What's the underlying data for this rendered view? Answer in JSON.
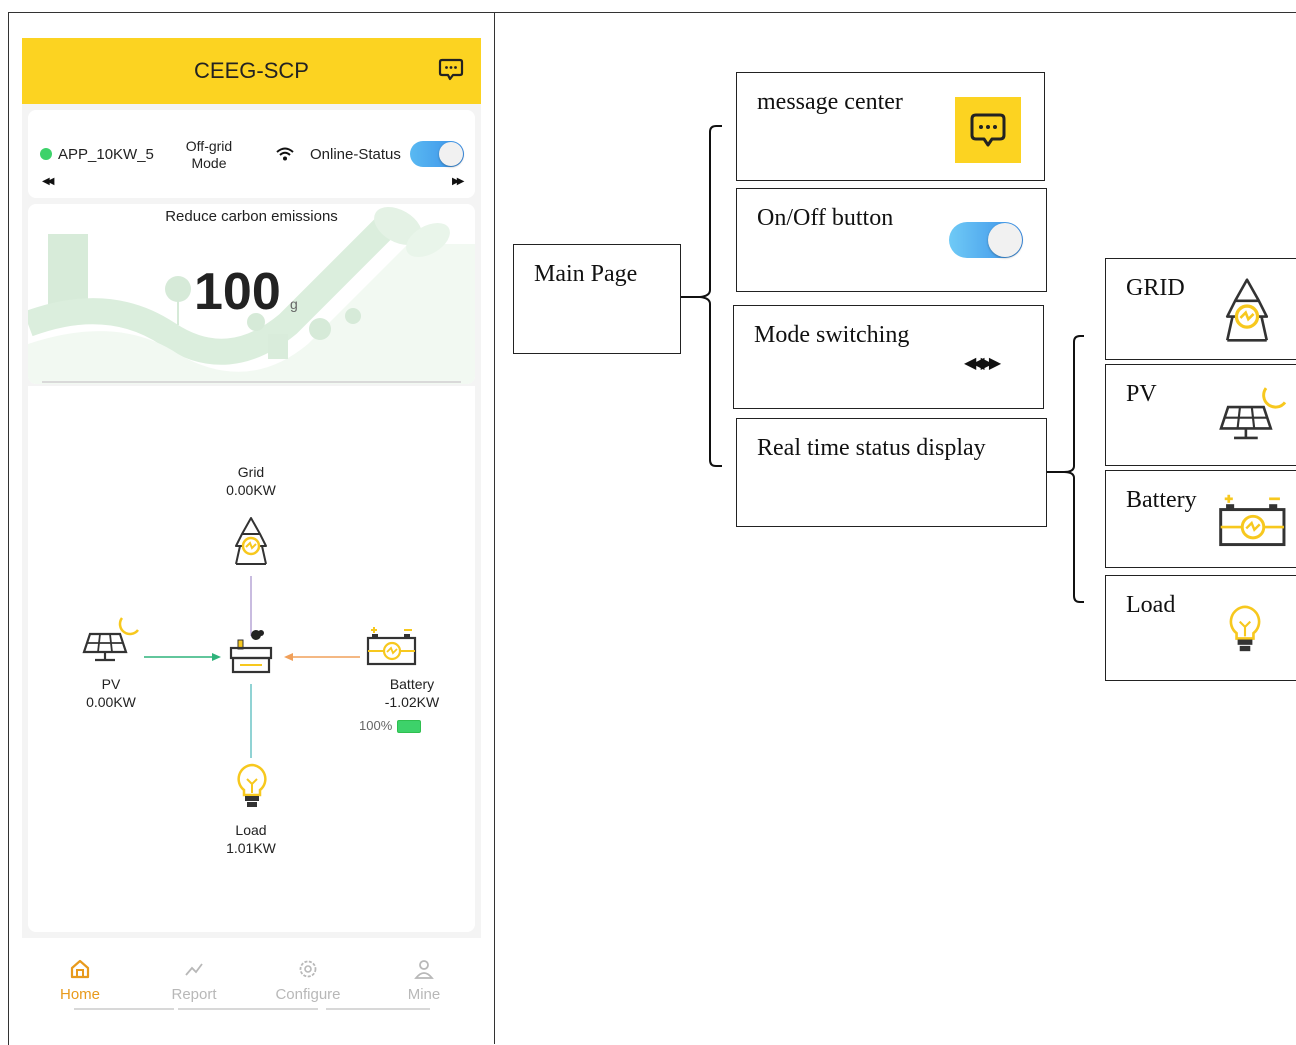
{
  "app": {
    "title": "CEEG-SCP",
    "device_name": "APP_10KW_5",
    "mode_label": "Off-grid Mode",
    "online_status_label": "Online-Status",
    "online_status_on": true,
    "carbon_title": "Reduce carbon emissions",
    "carbon_value": "100",
    "carbon_unit": "g"
  },
  "flow": {
    "grid": {
      "label": "Grid",
      "value": "0.00KW"
    },
    "pv": {
      "label": "PV",
      "value": "0.00KW"
    },
    "battery": {
      "label": "Battery",
      "value": "-1.02KW",
      "soc": "100%"
    },
    "load": {
      "label": "Load",
      "value": "1.01KW"
    }
  },
  "nav": [
    {
      "label": "Home",
      "icon": "home-icon",
      "active": true
    },
    {
      "label": "Report",
      "icon": "trend-icon",
      "active": false
    },
    {
      "label": "Configure",
      "icon": "gear-icon",
      "active": false
    },
    {
      "label": "Mine",
      "icon": "person-icon",
      "active": false
    }
  ],
  "diagram": {
    "root": "Main Page",
    "features": [
      "message center",
      "On/Off button",
      "Mode switching",
      "Real time status display"
    ],
    "status_items": [
      "GRID",
      "PV",
      "Battery",
      "Load"
    ]
  },
  "colors": {
    "brand_yellow": "#fcd321",
    "icon_yellow": "#f7c81e",
    "toggle_blue": "#3a8fe8",
    "online_green": "#3dd26a",
    "nav_active": "#e89a1c"
  }
}
